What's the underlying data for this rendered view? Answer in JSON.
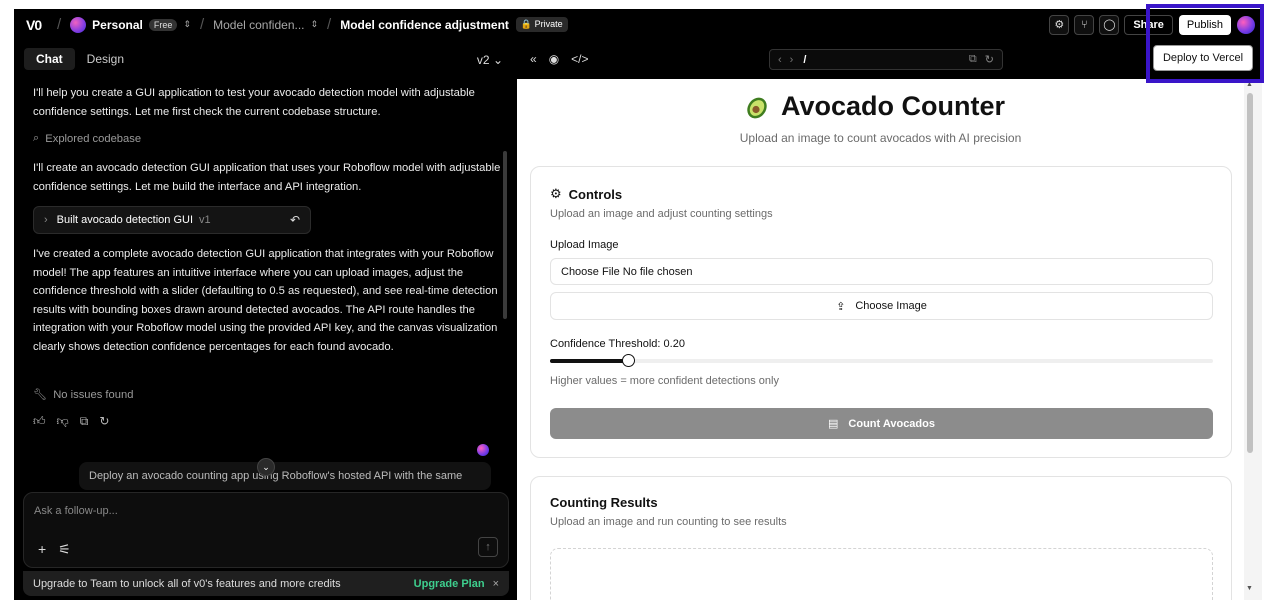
{
  "topbar": {
    "logo": "V0",
    "team": "Personal",
    "plan_badge": "Free",
    "project_crumb": "Model confiden...",
    "chat_title": "Model confidence adjustment",
    "visibility": "Private",
    "share_label": "Share",
    "publish_label": "Publish",
    "tooltip": "Deploy to Vercel"
  },
  "chat": {
    "tabs": [
      "Chat",
      "Design"
    ],
    "version": "v2",
    "messages": {
      "intro": "I'll help you create a GUI application to test your avocado detection model with adjustable confidence settings. Let me first check the current codebase structure.",
      "explored": "Explored codebase",
      "plan": "I'll create an avocado detection GUI application that uses your Roboflow model with adjustable confidence settings. Let me build the interface and API integration.",
      "version_card": "Built avocado detection GUI",
      "version_card_tag": "v1",
      "summary": "I've created a complete avocado detection GUI application that integrates with your Roboflow model! The app features an intuitive interface where you can upload images, adjust the confidence threshold with a slider (defaulting to 0.5 as requested), and see real-time detection results with bounding boxes drawn around detected avocados. The API route handles the integration with your Roboflow model using the provided API key, and the canvas visualization clearly shows detection confidence percentages for each found avocado.",
      "no_issues": "No issues found",
      "pending_user": "Deploy an avocado counting app using Roboflow's hosted API with the same"
    },
    "composer_placeholder": "Ask a follow-up...",
    "upgrade_text": "Upgrade to Team to unlock all of v0's features and more credits",
    "upgrade_link": "Upgrade Plan"
  },
  "preview_bar": {
    "path": "/"
  },
  "app": {
    "title": "Avocado Counter",
    "subtitle": "Upload an image to count avocados with AI precision",
    "controls": {
      "title": "Controls",
      "desc": "Upload an image and adjust counting settings",
      "upload_label": "Upload Image",
      "file_input_text": "Choose File No file chosen",
      "choose_button": "Choose Image",
      "threshold_label": "Confidence Threshold: 0.20",
      "threshold_value": 0.2,
      "threshold_hint": "Higher values = more confident detections only",
      "count_button": "Count Avocados"
    },
    "results": {
      "title": "Counting Results",
      "desc": "Upload an image and run counting to see results"
    }
  },
  "colors": {
    "highlight": "#3a15c9",
    "upgrade_link": "#3ecf8e",
    "count_button_disabled": "#8c8c8c"
  }
}
